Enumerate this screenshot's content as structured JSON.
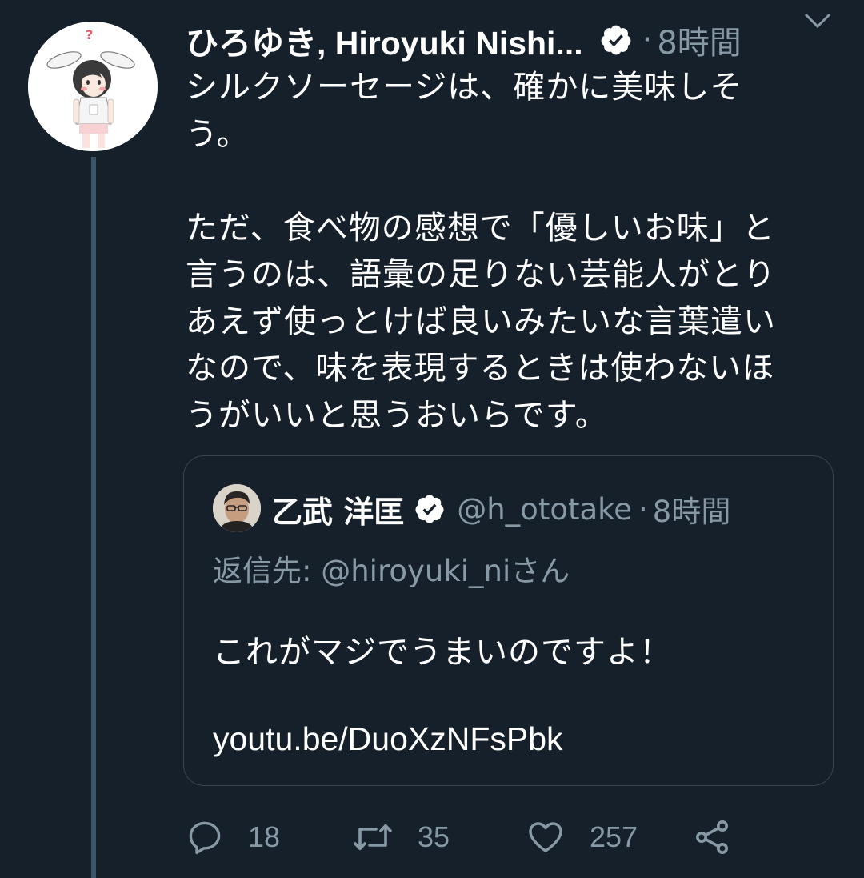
{
  "tweet": {
    "author_name": "ひろゆき, Hiroyuki Nishi...",
    "time": "8時間",
    "separator": "·",
    "body": "シルクソーセージは、確かに美味しそ\nう。\n\nただ、食べ物の感想で「優しいお味」と\n言うのは、語彙の足りない芸能人がとり\nあえず使っとけば良いみたいな言葉遣い\nなので、味を表現するときは使わないほ\nうがいいと思うおいらです。"
  },
  "quote": {
    "author_name": "乙武 洋匡",
    "handle": "@h_ototake",
    "separator": "·",
    "time": "8時間",
    "reply_to": "返信先: @hiroyuki_niさん",
    "text": "これがマジでうまいのですよ！",
    "link": "youtu.be/DuoXzNFsPbk"
  },
  "actions": {
    "reply_count": "18",
    "retweet_count": "35",
    "like_count": "257"
  },
  "icons": {
    "verified": "verified-badge-icon",
    "caret": "chevron-down-icon",
    "reply": "reply-bubble-icon",
    "retweet": "retweet-icon",
    "like": "heart-icon",
    "share": "share-icon"
  },
  "colors": {
    "background": "#15202b",
    "secondary_text": "#8899a6",
    "border": "#38444d",
    "thread_line": "#3d5466"
  }
}
